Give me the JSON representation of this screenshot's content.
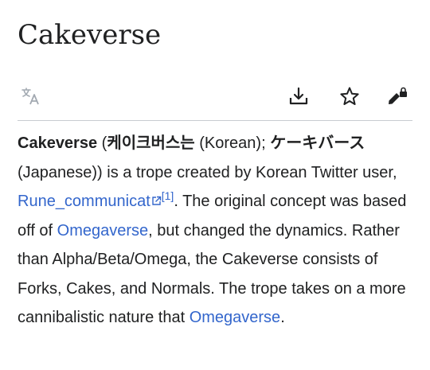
{
  "article": {
    "title": "Cakeverse",
    "body": {
      "term": "Cakeverse",
      "paren_open": " (",
      "korean_term": "케이크버스는",
      "korean_lang": " (Korean); ",
      "japanese_term": "ケーキバース",
      "sentence1_rest": " (Japanese)) is a trope created by Korean Twitter user, ",
      "author_link": "Rune_communicat",
      "ref_mark": "[1]",
      "sentence2_start": ". The original concept was based off of ",
      "omegaverse_link_1": "Omegaverse",
      "sentence2_rest": ", but changed the dynamics. Rather than Alpha/Beta/Omega, the Cakeverse consists of Forks, Cakes, and Normals. The trope takes on a more cannibalistic nature that ",
      "omegaverse_link_2": "Omegaverse",
      "end_period": "."
    }
  },
  "toolbar": {
    "icons": [
      "language-icon",
      "download-icon",
      "star-icon",
      "edit-lock-icon"
    ]
  },
  "colors": {
    "text": "#202122",
    "link": "#3366cc",
    "icon": "#202122",
    "icon_disabled": "#a2a9b1",
    "divider": "#c8ccd1"
  }
}
